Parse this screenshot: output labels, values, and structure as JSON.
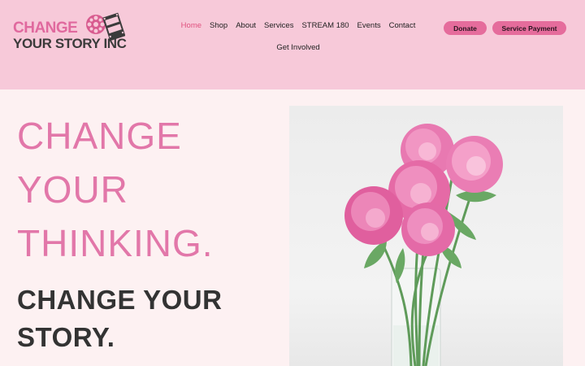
{
  "logo": {
    "line1": "CHANGE",
    "line2": "YOUR STORY INC"
  },
  "nav": {
    "row1": [
      "Home",
      "Shop",
      "About",
      "Services",
      "STREAM 180",
      "Events",
      "Contact"
    ],
    "row2": [
      "Get Involved"
    ],
    "active": "Home"
  },
  "header_buttons": {
    "donate": "Donate",
    "service_payment": "Service Payment"
  },
  "hero": {
    "lines": [
      "CHANGE",
      "YOUR",
      "THINKING."
    ],
    "subline": "CHANGE YOUR STORY."
  },
  "colors": {
    "header_bg": "#f7c9d9",
    "page_bg": "#fdf1f2",
    "accent_pink": "#e277a9",
    "button_pink": "#e56c9c",
    "dark_text": "#333333"
  },
  "photo": {
    "icon": "pink-peonies-in-glass-vase"
  }
}
